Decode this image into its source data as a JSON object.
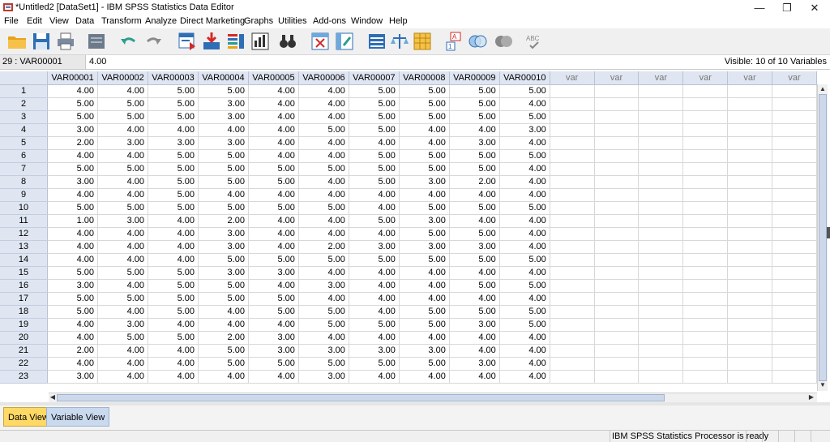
{
  "window": {
    "title": "*Untitled2 [DataSet1] - IBM SPSS Statistics Data Editor",
    "minimize": "—",
    "maximize": "❐",
    "close": "✕"
  },
  "menu": [
    "File",
    "Edit",
    "View",
    "Data",
    "Transform",
    "Analyze",
    "Direct Marketing",
    "Graphs",
    "Utilities",
    "Add-ons",
    "Window",
    "Help"
  ],
  "cellbar": {
    "ref": "29 : VAR00001",
    "value": "4.00",
    "visible": "Visible: 10 of 10 Variables"
  },
  "grid": {
    "columns": [
      "VAR00001",
      "VAR00002",
      "VAR00003",
      "VAR00004",
      "VAR00005",
      "VAR00006",
      "VAR00007",
      "VAR00008",
      "VAR00009",
      "VAR00010"
    ],
    "empty_columns": [
      "var",
      "var",
      "var",
      "var",
      "var",
      "var"
    ],
    "rows": [
      [
        "4.00",
        "4.00",
        "5.00",
        "5.00",
        "4.00",
        "4.00",
        "5.00",
        "5.00",
        "5.00",
        "5.00"
      ],
      [
        "5.00",
        "5.00",
        "5.00",
        "3.00",
        "4.00",
        "4.00",
        "5.00",
        "5.00",
        "5.00",
        "4.00"
      ],
      [
        "5.00",
        "5.00",
        "5.00",
        "3.00",
        "4.00",
        "4.00",
        "5.00",
        "5.00",
        "5.00",
        "5.00"
      ],
      [
        "3.00",
        "4.00",
        "4.00",
        "4.00",
        "4.00",
        "5.00",
        "5.00",
        "4.00",
        "4.00",
        "3.00"
      ],
      [
        "2.00",
        "3.00",
        "3.00",
        "3.00",
        "4.00",
        "4.00",
        "4.00",
        "4.00",
        "3.00",
        "4.00"
      ],
      [
        "4.00",
        "4.00",
        "5.00",
        "5.00",
        "4.00",
        "4.00",
        "5.00",
        "5.00",
        "5.00",
        "5.00"
      ],
      [
        "5.00",
        "5.00",
        "5.00",
        "5.00",
        "5.00",
        "5.00",
        "5.00",
        "5.00",
        "5.00",
        "4.00"
      ],
      [
        "3.00",
        "4.00",
        "5.00",
        "5.00",
        "5.00",
        "4.00",
        "5.00",
        "3.00",
        "2.00",
        "4.00"
      ],
      [
        "4.00",
        "4.00",
        "5.00",
        "4.00",
        "4.00",
        "4.00",
        "4.00",
        "4.00",
        "4.00",
        "4.00"
      ],
      [
        "5.00",
        "5.00",
        "5.00",
        "5.00",
        "5.00",
        "5.00",
        "4.00",
        "5.00",
        "5.00",
        "5.00"
      ],
      [
        "1.00",
        "3.00",
        "4.00",
        "2.00",
        "4.00",
        "4.00",
        "5.00",
        "3.00",
        "4.00",
        "4.00"
      ],
      [
        "4.00",
        "4.00",
        "4.00",
        "3.00",
        "4.00",
        "4.00",
        "4.00",
        "5.00",
        "5.00",
        "4.00"
      ],
      [
        "4.00",
        "4.00",
        "4.00",
        "3.00",
        "4.00",
        "2.00",
        "3.00",
        "3.00",
        "3.00",
        "4.00"
      ],
      [
        "4.00",
        "4.00",
        "4.00",
        "5.00",
        "5.00",
        "5.00",
        "5.00",
        "5.00",
        "5.00",
        "5.00"
      ],
      [
        "5.00",
        "5.00",
        "5.00",
        "3.00",
        "3.00",
        "4.00",
        "4.00",
        "4.00",
        "4.00",
        "4.00"
      ],
      [
        "3.00",
        "4.00",
        "5.00",
        "5.00",
        "4.00",
        "3.00",
        "4.00",
        "4.00",
        "5.00",
        "5.00"
      ],
      [
        "5.00",
        "5.00",
        "5.00",
        "5.00",
        "5.00",
        "4.00",
        "4.00",
        "4.00",
        "4.00",
        "4.00"
      ],
      [
        "5.00",
        "4.00",
        "5.00",
        "4.00",
        "5.00",
        "5.00",
        "4.00",
        "5.00",
        "5.00",
        "5.00"
      ],
      [
        "4.00",
        "3.00",
        "4.00",
        "4.00",
        "4.00",
        "5.00",
        "5.00",
        "5.00",
        "3.00",
        "5.00"
      ],
      [
        "4.00",
        "5.00",
        "5.00",
        "2.00",
        "3.00",
        "4.00",
        "4.00",
        "4.00",
        "4.00",
        "4.00"
      ],
      [
        "2.00",
        "4.00",
        "4.00",
        "5.00",
        "3.00",
        "3.00",
        "3.00",
        "3.00",
        "4.00",
        "4.00"
      ],
      [
        "4.00",
        "4.00",
        "4.00",
        "5.00",
        "5.00",
        "5.00",
        "5.00",
        "5.00",
        "3.00",
        "4.00"
      ],
      [
        "3.00",
        "4.00",
        "4.00",
        "4.00",
        "4.00",
        "3.00",
        "4.00",
        "4.00",
        "4.00",
        "4.00"
      ]
    ]
  },
  "tabs": {
    "data_view": "Data View",
    "variable_view": "Variable View"
  },
  "status": "IBM SPSS Statistics Processor is ready",
  "colors": {
    "active_tab": "#ffd966",
    "header_bg": "#dfe6f1"
  }
}
